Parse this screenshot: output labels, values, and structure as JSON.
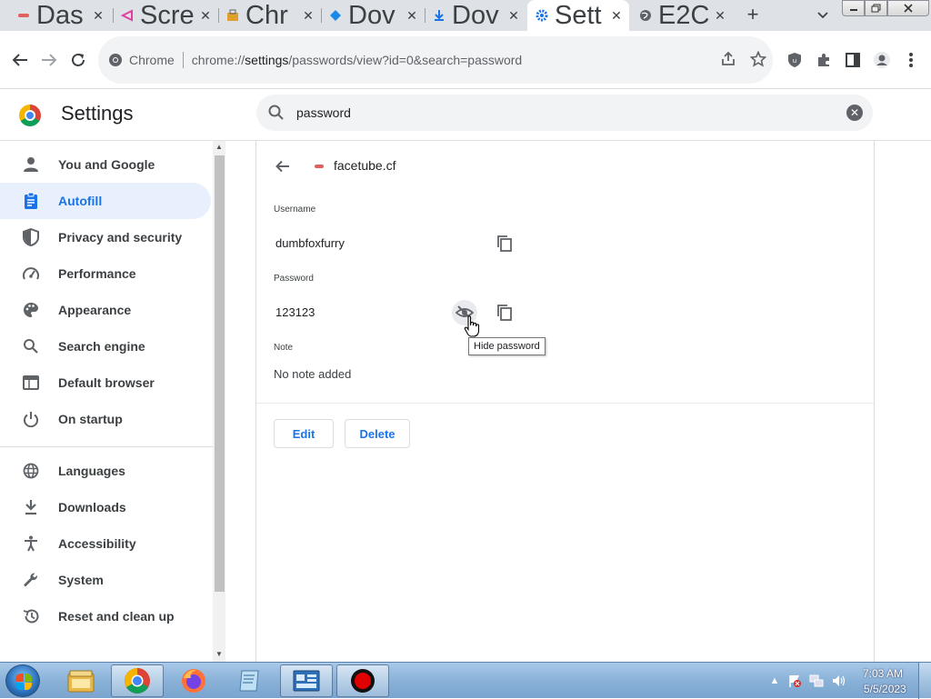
{
  "browser": {
    "tabs": [
      {
        "title": "Das",
        "icon": "dashboard-icon",
        "color": "#e06060"
      },
      {
        "title": "Scre",
        "icon": "screen-icon",
        "color": "#e040a0"
      },
      {
        "title": "Chr",
        "icon": "chrome-web-store-icon",
        "color": "#e0a030"
      },
      {
        "title": "Dov",
        "icon": "diamond-icon",
        "color": "#1a8ae8"
      },
      {
        "title": "Dov",
        "icon": "download-icon",
        "color": "#1a73e8"
      },
      {
        "title": "Sett",
        "icon": "gear-icon",
        "color": "#1a73e8"
      },
      {
        "title": "E2C",
        "icon": "globe-icon",
        "color": "#5f6368"
      }
    ],
    "active_tab": 5,
    "omnibox": {
      "site_label": "Chrome",
      "url_prefix": "chrome://",
      "url_host": "settings",
      "url_rest": "/passwords/view?id=0&search=password"
    }
  },
  "settings": {
    "title": "Settings",
    "search_value": "password",
    "nav": [
      {
        "label": "You and Google",
        "icon": "person-icon"
      },
      {
        "label": "Autofill",
        "icon": "autofill-clipboard-icon",
        "active": true
      },
      {
        "label": "Privacy and security",
        "icon": "shield-icon"
      },
      {
        "label": "Performance",
        "icon": "speedometer-icon"
      },
      {
        "label": "Appearance",
        "icon": "palette-icon"
      },
      {
        "label": "Search engine",
        "icon": "search-icon"
      },
      {
        "label": "Default browser",
        "icon": "browser-window-icon"
      },
      {
        "label": "On startup",
        "icon": "power-icon"
      },
      {
        "label": "Languages",
        "icon": "globe-icon"
      },
      {
        "label": "Downloads",
        "icon": "download-icon"
      },
      {
        "label": "Accessibility",
        "icon": "accessibility-icon"
      },
      {
        "label": "System",
        "icon": "wrench-icon"
      },
      {
        "label": "Reset and clean up",
        "icon": "restore-icon"
      }
    ],
    "detail": {
      "site": "facetube.cf",
      "username_label": "Username",
      "username": "dumbfoxfurry",
      "password_label": "Password",
      "password": "123123",
      "note_label": "Note",
      "note": "No note added",
      "tooltip": "Hide password",
      "edit_label": "Edit",
      "delete_label": "Delete"
    }
  },
  "taskbar": {
    "time": "7:03 AM",
    "date": "5/5/2023",
    "apps": [
      "file-explorer-icon",
      "chrome-icon",
      "firefox-icon",
      "notepad-icon",
      "control-panel-icon",
      "record-icon"
    ]
  },
  "colors": {
    "accent": "#1a73e8",
    "active_nav_bg": "#e8f0fe"
  }
}
